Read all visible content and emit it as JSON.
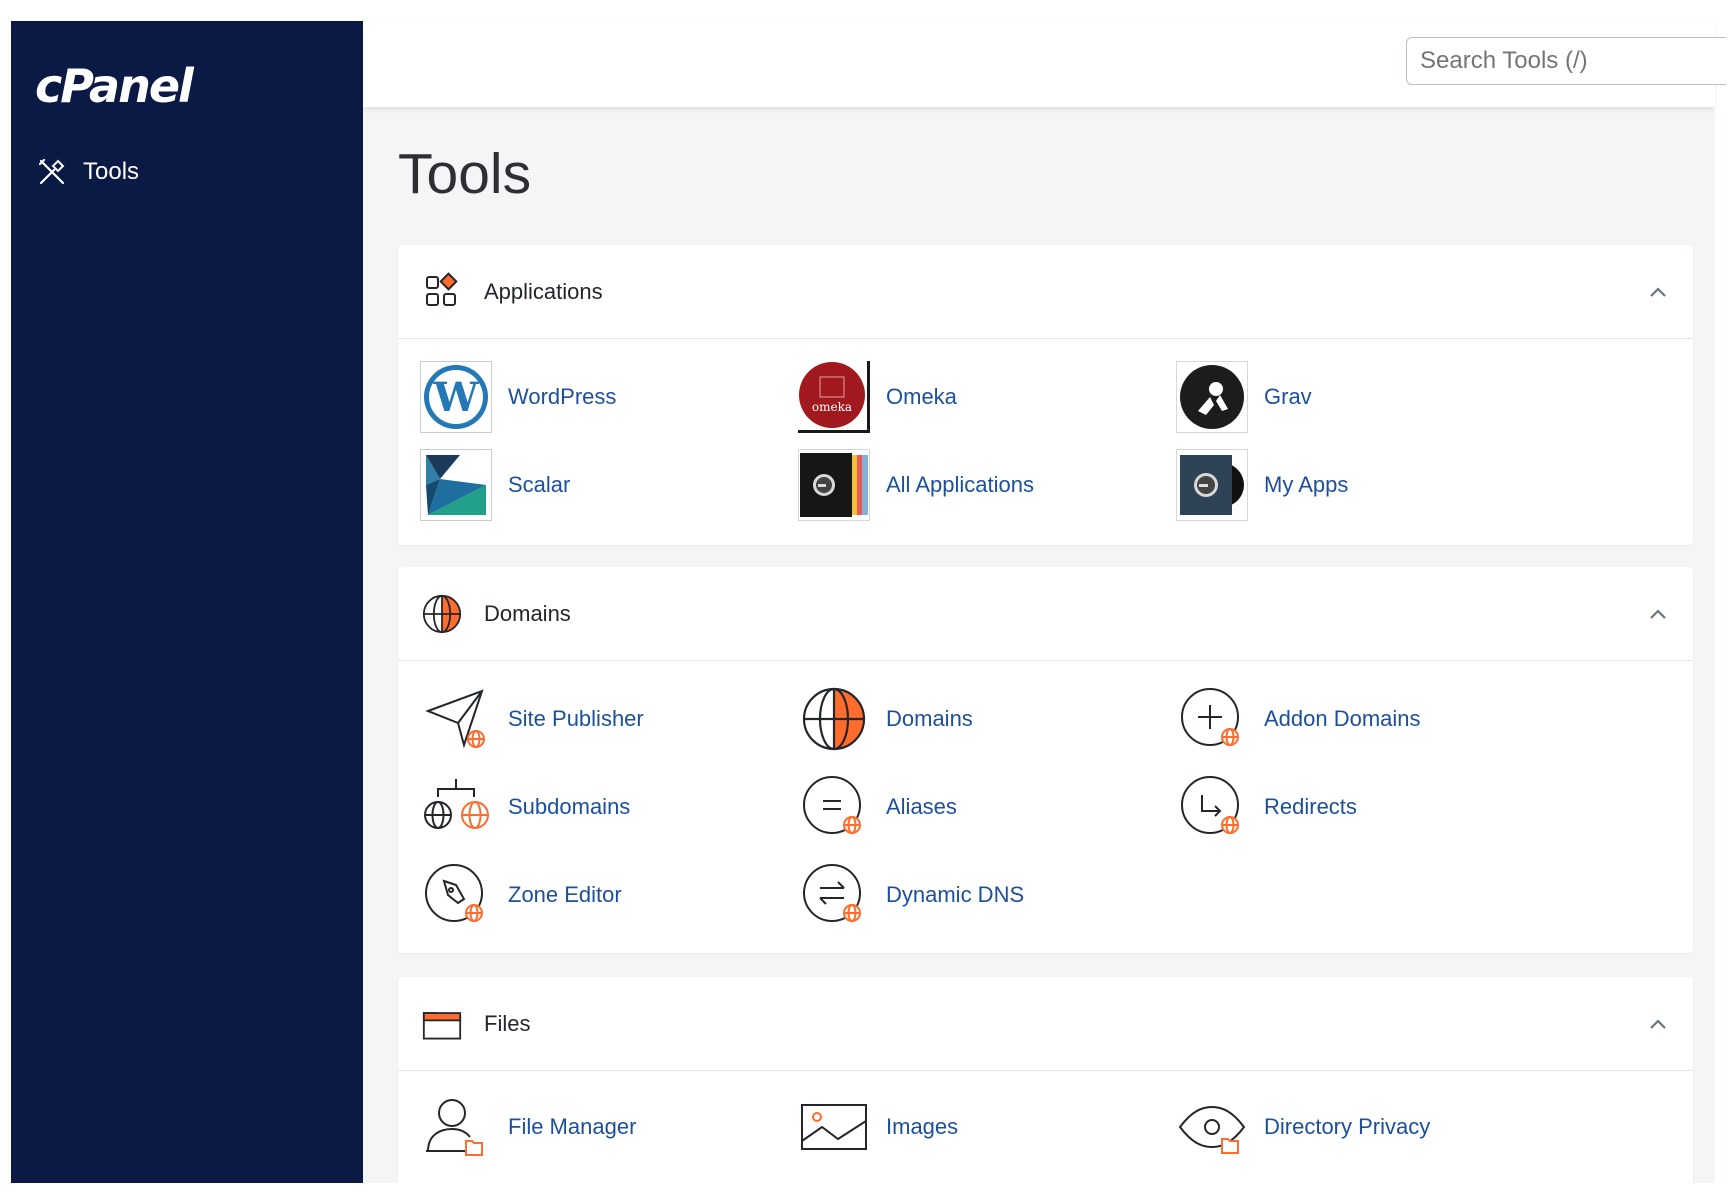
{
  "brand": {
    "logo_text": "cPanel"
  },
  "sidebar": {
    "items": [
      {
        "label": "Tools",
        "icon": "tools-icon"
      }
    ]
  },
  "search": {
    "placeholder": "Search Tools (/)"
  },
  "page_title": "Tools",
  "colors": {
    "sidebar_bg": "#0b1a45",
    "link": "#1d4f9c",
    "accent": "#ff6c2c",
    "page_bg": "#f4f5f7"
  },
  "sections": {
    "applications": {
      "title": "Applications",
      "items": [
        {
          "label": "WordPress",
          "icon": "wordpress-icon"
        },
        {
          "label": "Omeka",
          "icon": "omeka-icon"
        },
        {
          "label": "Grav",
          "icon": "grav-icon"
        },
        {
          "label": "Scalar",
          "icon": "scalar-icon"
        },
        {
          "label": "All Applications",
          "icon": "all-applications-icon"
        },
        {
          "label": "My Apps",
          "icon": "my-apps-icon"
        }
      ]
    },
    "domains": {
      "title": "Domains",
      "items": [
        {
          "label": "Site Publisher",
          "icon": "site-publisher-icon"
        },
        {
          "label": "Domains",
          "icon": "globe-icon"
        },
        {
          "label": "Addon Domains",
          "icon": "addon-domains-icon"
        },
        {
          "label": "Subdomains",
          "icon": "subdomains-icon"
        },
        {
          "label": "Aliases",
          "icon": "aliases-icon"
        },
        {
          "label": "Redirects",
          "icon": "redirects-icon"
        },
        {
          "label": "Zone Editor",
          "icon": "zone-editor-icon"
        },
        {
          "label": "Dynamic DNS",
          "icon": "dynamic-dns-icon"
        }
      ]
    },
    "files": {
      "title": "Files",
      "items": [
        {
          "label": "File Manager",
          "icon": "file-manager-icon"
        },
        {
          "label": "Images",
          "icon": "images-icon"
        },
        {
          "label": "Directory Privacy",
          "icon": "directory-privacy-icon"
        }
      ]
    }
  }
}
